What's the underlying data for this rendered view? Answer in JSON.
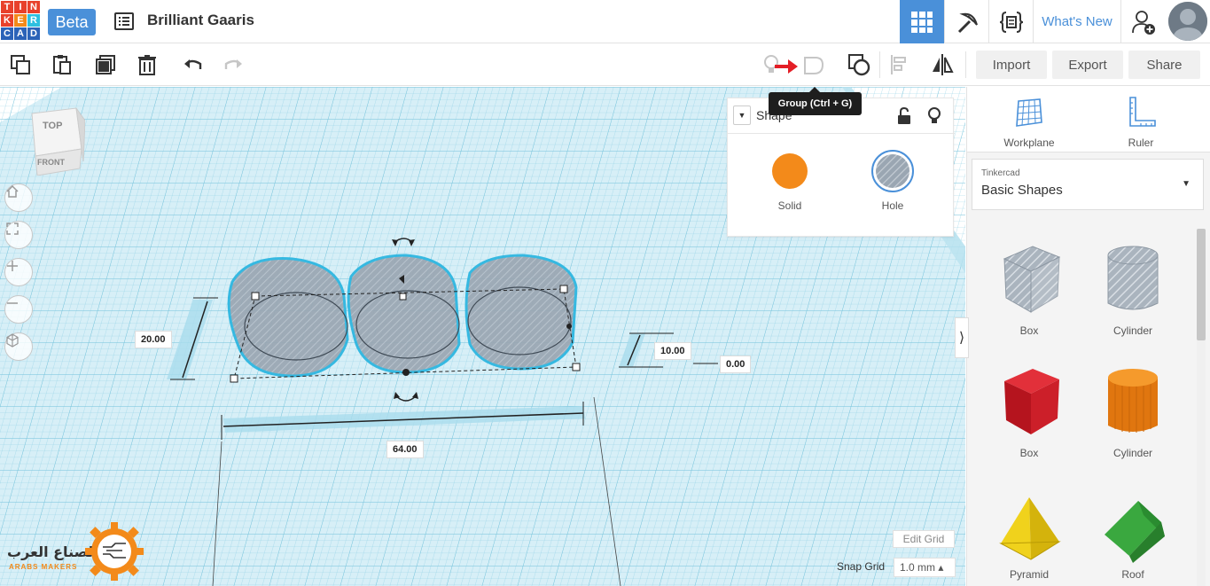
{
  "header": {
    "logo_letters": [
      "T",
      "I",
      "N",
      "K",
      "E",
      "R",
      "C",
      "A",
      "D"
    ],
    "logo_colors": [
      "#e8412b",
      "#e8412b",
      "#e8412b",
      "#e8412b",
      "#f38a1a",
      "#2dc0e0",
      "#2b63b8",
      "#2b63b8",
      "#2b63b8"
    ],
    "beta_label": "Beta",
    "project_title": "Brilliant Gaaris",
    "whats_new": "What's New",
    "accent": "#4a90d9"
  },
  "toolbar": {
    "import_label": "Import",
    "export_label": "Export",
    "share_label": "Share",
    "tooltip": "Group (Ctrl + G)"
  },
  "viewcube": {
    "top_label": "TOP",
    "front_label": "FRONT"
  },
  "inspector": {
    "title": "Shape",
    "solid_label": "Solid",
    "hole_label": "Hole",
    "solid_color": "#f38a1a"
  },
  "dimensions": {
    "height": "20.00",
    "elevation_top": "10.00",
    "elevation": "0.00",
    "width": "64.00"
  },
  "panel": {
    "workplane_label": "Workplane",
    "ruler_label": "Ruler",
    "library_small": "Tinkercad",
    "library_big": "Basic Shapes",
    "shapes": [
      {
        "label": "Box",
        "icon": "box-hole-icon"
      },
      {
        "label": "Cylinder",
        "icon": "cylinder-hole-icon"
      },
      {
        "label": "Box",
        "icon": "box-red-icon"
      },
      {
        "label": "Cylinder",
        "icon": "cylinder-orange-icon"
      },
      {
        "label": "Pyramid",
        "icon": "pyramid-icon"
      },
      {
        "label": "Roof",
        "icon": "roof-icon"
      }
    ]
  },
  "grid_controls": {
    "edit_grid": "Edit Grid",
    "snap_label": "Snap Grid",
    "snap_value": "1.0 mm ▴"
  },
  "watermark": {
    "arabic": "الصناع العرب",
    "english": "ARABS MAKERS"
  }
}
